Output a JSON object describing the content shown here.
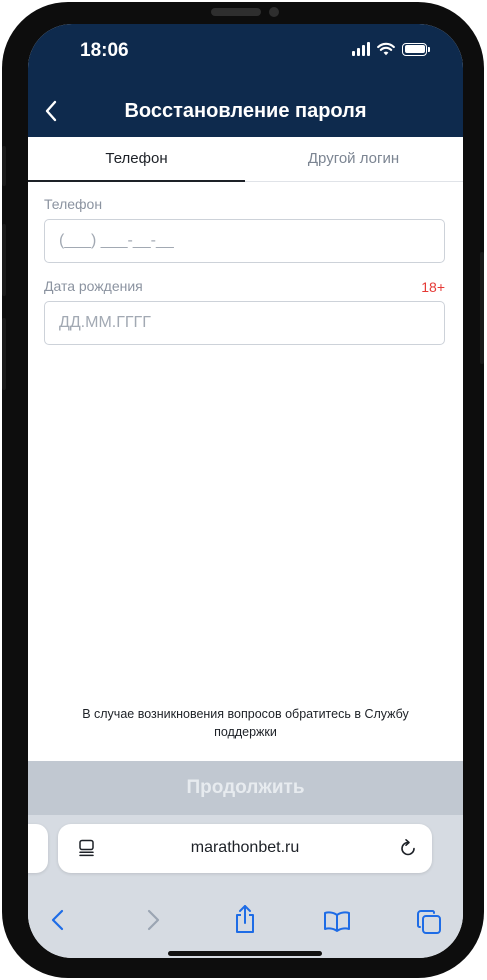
{
  "status_bar": {
    "time": "18:06"
  },
  "header": {
    "title": "Восстановление пароля"
  },
  "tabs": [
    {
      "label": "Телефон",
      "active": true
    },
    {
      "label": "Другой логин",
      "active": false
    }
  ],
  "form": {
    "phone": {
      "label": "Телефон",
      "placeholder": "(___) ___-__-__",
      "value": ""
    },
    "birthdate": {
      "label": "Дата рождения",
      "placeholder": "ДД.ММ.ГГГГ",
      "value": "",
      "age_badge": "18+"
    }
  },
  "support_text": "В случае возникновения вопросов обратитесь в Службу поддержки",
  "continue_button": {
    "label": "Продолжить",
    "enabled": false
  },
  "browser": {
    "url": "marathonbet.ru",
    "toolbar_icons": [
      "back-icon",
      "forward-icon",
      "share-icon",
      "bookmarks-icon",
      "tabs-icon"
    ]
  },
  "colors": {
    "header_bg": "#0e2a4d",
    "accent_text": "#1d2127",
    "age_badge": "#e53935",
    "button_disabled_bg": "#c1c8d1",
    "safari_blue": "#1e6ce6"
  }
}
